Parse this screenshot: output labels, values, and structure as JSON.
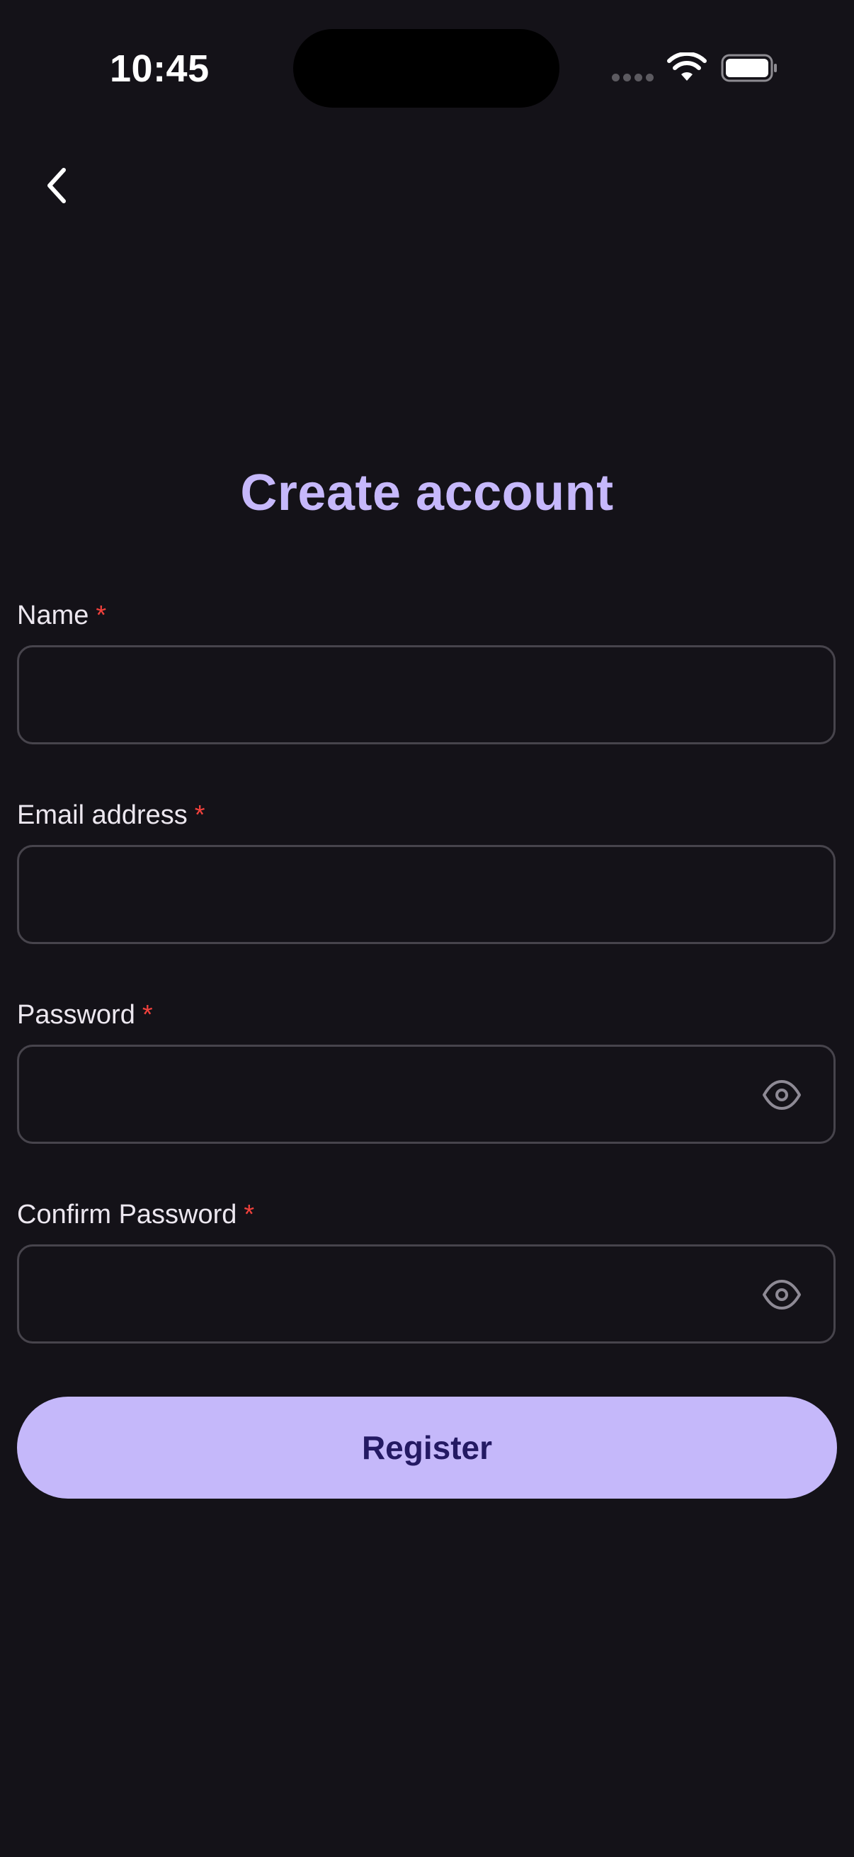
{
  "status_bar": {
    "time": "10:45"
  },
  "header": {
    "back_icon": "chevron-left-icon"
  },
  "title": "Create account",
  "form": {
    "required_marker": "*",
    "fields": [
      {
        "label": "Name",
        "value": "",
        "placeholder": ""
      },
      {
        "label": "Email address",
        "value": "",
        "placeholder": ""
      },
      {
        "label": "Password",
        "value": "",
        "placeholder": "",
        "toggle_icon": "eye-icon"
      },
      {
        "label": "Confirm Password",
        "value": "",
        "placeholder": "",
        "toggle_icon": "eye-icon"
      }
    ],
    "submit_label": "Register"
  },
  "colors": {
    "background": "#141218",
    "accent": "#c5b8fa",
    "accent_text": "#241a63",
    "required": "#f0413c",
    "field_border": "#47444c"
  }
}
